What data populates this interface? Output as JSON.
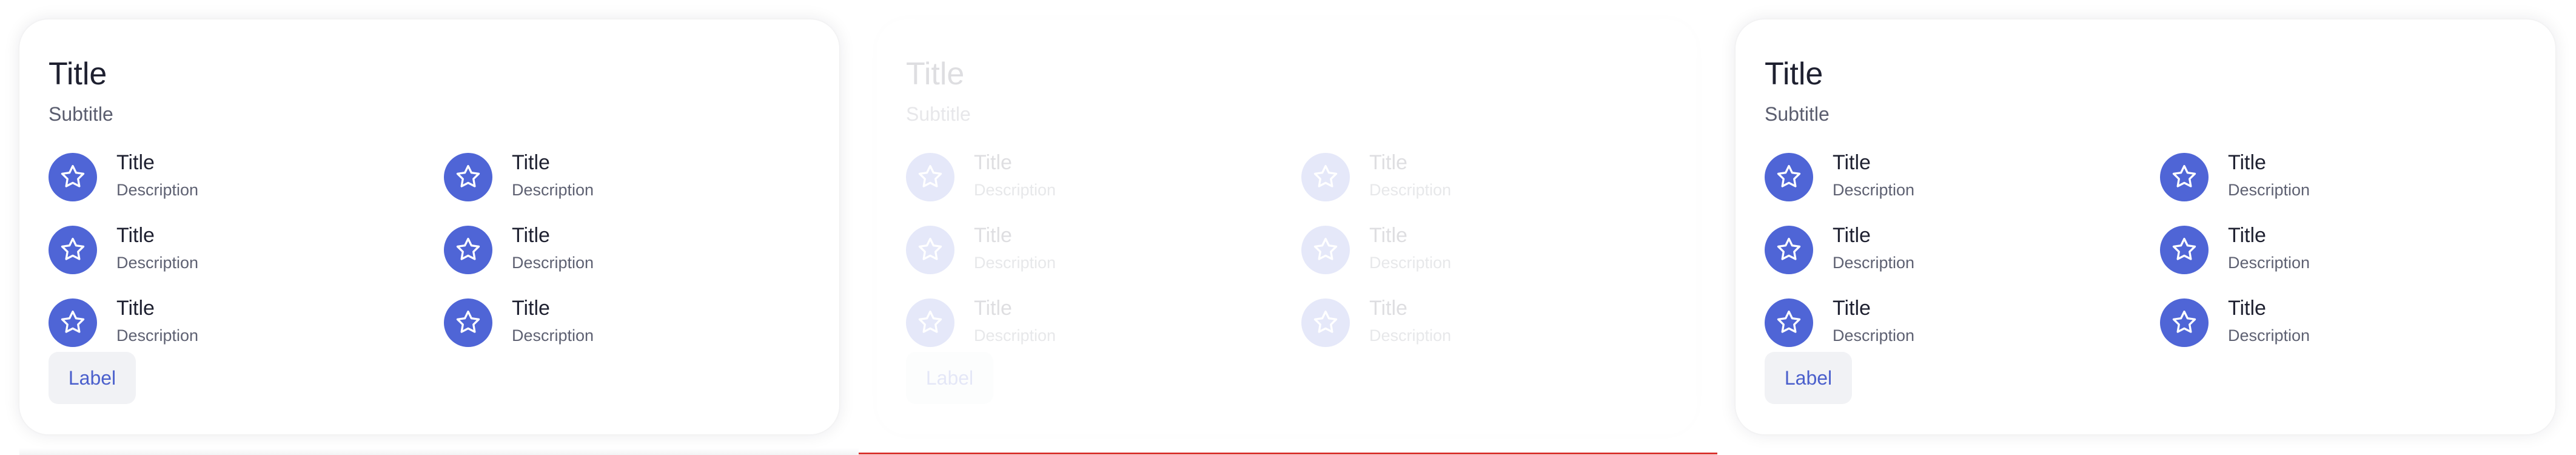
{
  "icons": {
    "item_icon": "star-icon"
  },
  "colors": {
    "accent": "#4f65d6",
    "button_text": "#4a5fcc",
    "bottom_line": "#d9332f"
  },
  "cards": [
    {
      "title": "Title",
      "subtitle": "Subtitle",
      "items": [
        {
          "title": "Title",
          "description": "Description"
        },
        {
          "title": "Title",
          "description": "Description"
        },
        {
          "title": "Title",
          "description": "Description"
        },
        {
          "title": "Title",
          "description": "Description"
        },
        {
          "title": "Title",
          "description": "Description"
        },
        {
          "title": "Title",
          "description": "Description"
        }
      ],
      "button_label": "Label"
    },
    {
      "title": "Title",
      "subtitle": "Subtitle",
      "items": [
        {
          "title": "Title",
          "description": "Description"
        },
        {
          "title": "Title",
          "description": "Description"
        },
        {
          "title": "Title",
          "description": "Description"
        },
        {
          "title": "Title",
          "description": "Description"
        },
        {
          "title": "Title",
          "description": "Description"
        },
        {
          "title": "Title",
          "description": "Description"
        }
      ],
      "button_label": "Label"
    },
    {
      "title": "Title",
      "subtitle": "Subtitle",
      "items": [
        {
          "title": "Title",
          "description": "Description"
        },
        {
          "title": "Title",
          "description": "Description"
        },
        {
          "title": "Title",
          "description": "Description"
        },
        {
          "title": "Title",
          "description": "Description"
        },
        {
          "title": "Title",
          "description": "Description"
        },
        {
          "title": "Title",
          "description": "Description"
        }
      ],
      "button_label": "Label"
    }
  ]
}
